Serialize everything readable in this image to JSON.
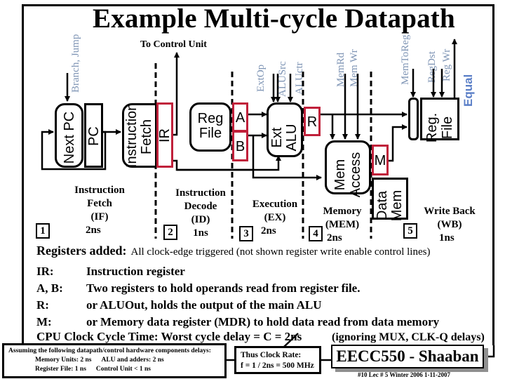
{
  "title": "Example Multi-cycle Datapath",
  "to_control_unit": "To Control Unit",
  "control_signals": {
    "branch_jump": "Branch, Jump",
    "ext_op": "ExtOp",
    "alu_src": "ALUSrc",
    "alu_ctr": "ALUctr",
    "mem_rd": "MemRd",
    "mem_wr": "Mem Wr",
    "mem_to_reg": "MemToReg",
    "reg_dst": "RegDst",
    "reg_wr": "Reg Wr",
    "equal": "Equal"
  },
  "blocks": {
    "next_pc": "Next PC",
    "pc": "PC",
    "instruction_fetch": [
      "Instruction",
      "Fetch"
    ],
    "ir": "IR",
    "reg_file": [
      "Reg",
      "File"
    ],
    "a": "A",
    "b": "B",
    "ext_alu": [
      "Ext",
      "ALU"
    ],
    "r": "R",
    "mem_access": [
      "Mem",
      "Access"
    ],
    "m": "M",
    "data_mem": [
      "Data",
      "Mem"
    ],
    "reg_file_wb": [
      "Reg.",
      "File"
    ]
  },
  "stages": [
    {
      "number": "1",
      "lines": [
        "Instruction",
        "Fetch",
        "(IF)",
        "2ns"
      ]
    },
    {
      "number": "2",
      "lines": [
        "Instruction",
        "Decode",
        "(ID)",
        "1ns"
      ]
    },
    {
      "number": "3",
      "lines": [
        "Execution",
        "(EX)",
        "2ns"
      ]
    },
    {
      "number": "4",
      "lines": [
        "Memory",
        "(MEM)",
        "2ns"
      ]
    },
    {
      "number": "5",
      "lines": [
        "Write Back",
        "(WB)",
        "1ns"
      ]
    }
  ],
  "registers_added": {
    "label": "Registers added:",
    "text": "All clock-edge triggered (not shown register write enable control lines)"
  },
  "definitions": [
    {
      "key": "IR:",
      "value": "Instruction register"
    },
    {
      "key": "A, B:",
      "value": "Two registers to hold operands read from register file."
    },
    {
      "key": "R:",
      "value": "or ALUOut, holds the output of the main ALU"
    },
    {
      "key": "M:",
      "value": "or Memory data register (MDR) to hold data read from data memory"
    }
  ],
  "cpu_clock": "CPU Clock Cycle Time:  Worst cycle delay = C = 2ns",
  "ignoring": "(ignoring MUX, CLK-Q delays)",
  "assumptions": {
    "heading": "Assuming the following datapath/control hardware components delays:",
    "memory_units": "Memory Units:  2 ns",
    "alu_adders": "ALU and adders:  2 ns",
    "register_file": "Register File:  1 ns",
    "control_unit": "Control Unit  < 1 ns"
  },
  "clock_rate": {
    "line1": "Thus Clock Rate:",
    "line2": "f = 1 / 2ns = 500 MHz"
  },
  "course_badge": "EECC550 - Shaaban",
  "footer": "#10   Lec # 5  Winter 2006  1-11-2007",
  "colors": {
    "register_border": "#c0203a",
    "control_signal": "#7f95b5",
    "equal_signal": "#5b7fc7",
    "badge_shadow": "#909090"
  }
}
